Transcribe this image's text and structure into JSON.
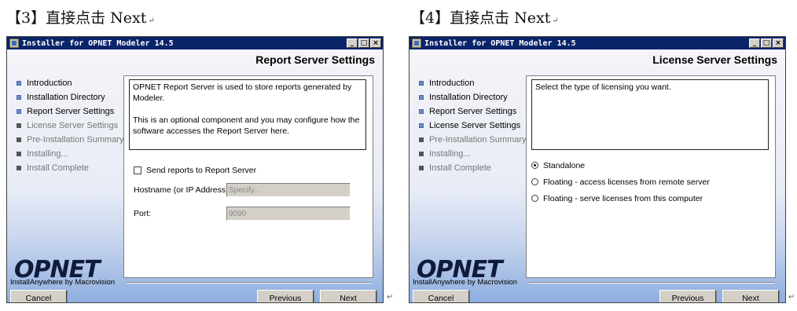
{
  "panels": [
    {
      "heading": "【3】直接点击 Next",
      "window_title": "Installer for OPNET Modeler 14.5",
      "page_title": "Report Server Settings",
      "steps": [
        {
          "label": "Introduction",
          "state": "done"
        },
        {
          "label": "Installation Directory",
          "state": "done"
        },
        {
          "label": "Report Server Settings",
          "state": "done"
        },
        {
          "label": "License Server Settings",
          "state": "pending"
        },
        {
          "label": "Pre-Installation Summary",
          "state": "pending"
        },
        {
          "label": "Installing...",
          "state": "pending"
        },
        {
          "label": "Install Complete",
          "state": "pending"
        }
      ],
      "description_p1": "OPNET Report Server is used to store reports generated by Modeler.",
      "description_p2": "This is an optional component and you may configure how the software accesses the Report Server here.",
      "checkbox_label": "Send reports to Report Server",
      "checkbox_checked": false,
      "hostname_label": "Hostname (or IP Address):",
      "hostname_value": "Specify...",
      "port_label": "Port:",
      "port_value": "9090",
      "logo": "OPNET",
      "logo_sub": "InstallAnywhere by Macrovision",
      "cancel_label": "Cancel",
      "previous_label": "Previous",
      "next_label": "Next"
    },
    {
      "heading": "【4】直接点击 Next",
      "window_title": "Installer for OPNET Modeler 14.5",
      "page_title": "License Server Settings",
      "steps": [
        {
          "label": "Introduction",
          "state": "done"
        },
        {
          "label": "Installation Directory",
          "state": "done"
        },
        {
          "label": "Report Server Settings",
          "state": "done"
        },
        {
          "label": "License Server Settings",
          "state": "done"
        },
        {
          "label": "Pre-Installation Summary",
          "state": "pending"
        },
        {
          "label": "Installing...",
          "state": "pending"
        },
        {
          "label": "Install Complete",
          "state": "pending"
        }
      ],
      "description": "Select the type of licensing you want.",
      "options": [
        {
          "label": "Standalone",
          "selected": true
        },
        {
          "label": "Floating - access licenses from remote server",
          "selected": false
        },
        {
          "label": "Floating - serve licenses from this computer",
          "selected": false
        }
      ],
      "logo": "OPNET",
      "logo_sub": "InstallAnywhere by Macrovision",
      "cancel_label": "Cancel",
      "previous_label": "Previous",
      "next_label": "Next"
    }
  ],
  "icons": {
    "return_mark": "↵",
    "minimize": "_",
    "maximize": "□",
    "close": "×"
  },
  "colors": {
    "titlebar": "#0a246a",
    "step_done_bullet": "#6d8cc8",
    "step_pending_bullet": "#555555",
    "panel_gradient_bottom": "#8eaee0"
  }
}
